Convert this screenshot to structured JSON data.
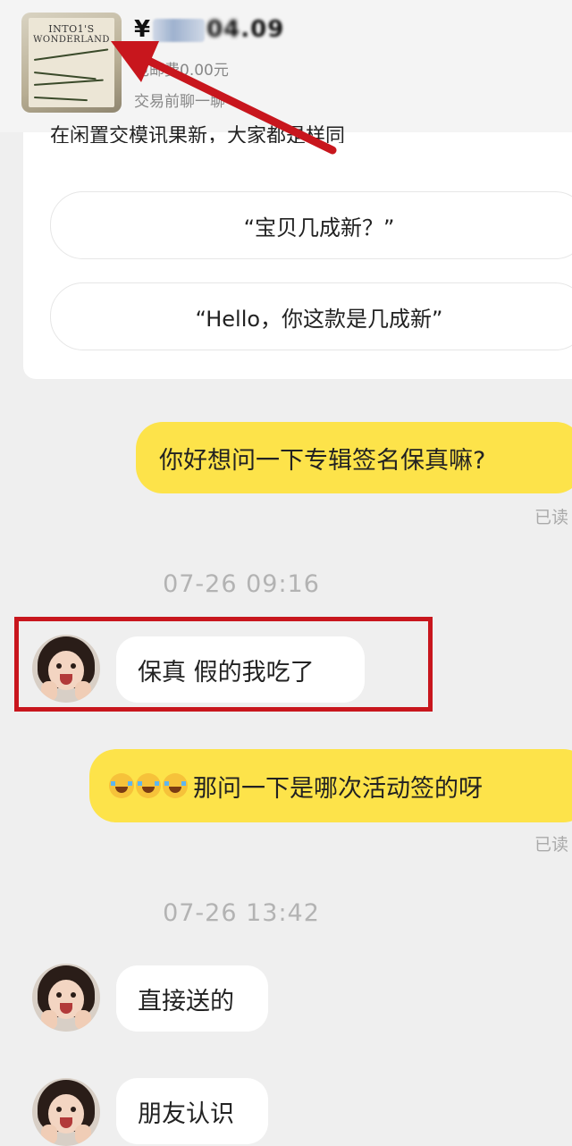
{
  "product": {
    "thumb_text_line1": "INTO1'S",
    "thumb_text_line2": "WONDERLAND",
    "price_prefix": "¥",
    "price_visible_mid": "04",
    "price_visible_tail": ".09",
    "shipping": "包邮费0.00元",
    "pretrade": "交易前聊一聊"
  },
  "suggestions": {
    "partial_text": "在闲置交模讯果新，大家都是样同",
    "items": [
      {
        "label": "“宝贝几成新？”"
      },
      {
        "label": "“Hello，你这款是几成新”"
      }
    ]
  },
  "messages": {
    "m1": {
      "text": "你好想问一下专辑签名保真嘛?",
      "read": "已读"
    },
    "t1": "07-26 09:16",
    "m2": {
      "text": "保真 假的我吃了"
    },
    "m3": {
      "text": "那问一下是哪次活动签的呀",
      "read": "已读",
      "emoji": "laughing-with-tears-emoji"
    },
    "t2": "07-26 13:42",
    "m4": {
      "text": "直接送的"
    },
    "m5": {
      "text": "朋友认识"
    }
  },
  "colors": {
    "self_bubble": "#fde34a",
    "other_bubble": "#ffffff",
    "highlight": "#c8161d",
    "arrow": "#c8161d",
    "background": "#efefef"
  }
}
